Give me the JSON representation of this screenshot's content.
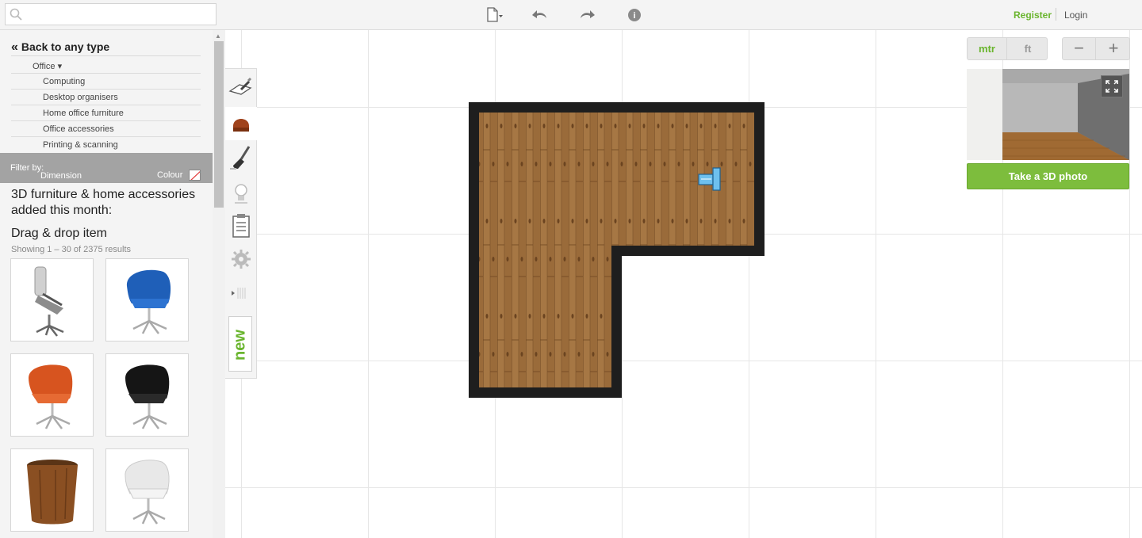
{
  "search": {
    "placeholder": "",
    "value": ""
  },
  "toolbar": {
    "new_icon": "new-file-dropdown-icon",
    "undo_icon": "undo-icon",
    "redo_icon": "redo-icon",
    "help_icon": "info-icon"
  },
  "auth": {
    "register": "Register",
    "login": "Login"
  },
  "sidebar": {
    "back": "Back to any type",
    "category": "Office ▾",
    "subcategories": [
      "Computing",
      "Desktop organisers",
      "Home office furniture",
      "Office accessories",
      "Printing & scanning"
    ],
    "filter": {
      "label": "Filter by:",
      "dimension": "Dimension",
      "colour": "Colour"
    },
    "heading": "3D furniture & home accessories added this month:",
    "drag_title": "Drag & drop item",
    "results": "Showing 1 – 30 of 2375 results",
    "items": [
      {
        "name": "grey-office-chair"
      },
      {
        "name": "blue-shell-chair"
      },
      {
        "name": "orange-shell-chair"
      },
      {
        "name": "black-shell-chair"
      },
      {
        "name": "wooden-bin"
      },
      {
        "name": "white-shell-chair"
      }
    ]
  },
  "tools": {
    "items": [
      "draw-walls-icon",
      "furniture-icon",
      "paint-brush-icon",
      "light-bulb-icon",
      "clipboard-icon",
      "settings-gear-icon",
      "collapse-icon"
    ],
    "new_label": "new"
  },
  "units": {
    "metric": "mtr",
    "imperial": "ft",
    "active": "mtr"
  },
  "zoom": {
    "out": "−",
    "in": "+"
  },
  "preview": {
    "button": "Take a 3D photo"
  },
  "colors": {
    "accent": "#6ab52e",
    "button": "#7dbd3d",
    "wall": "#1e1e1e",
    "floor": "#9a6b3a"
  }
}
